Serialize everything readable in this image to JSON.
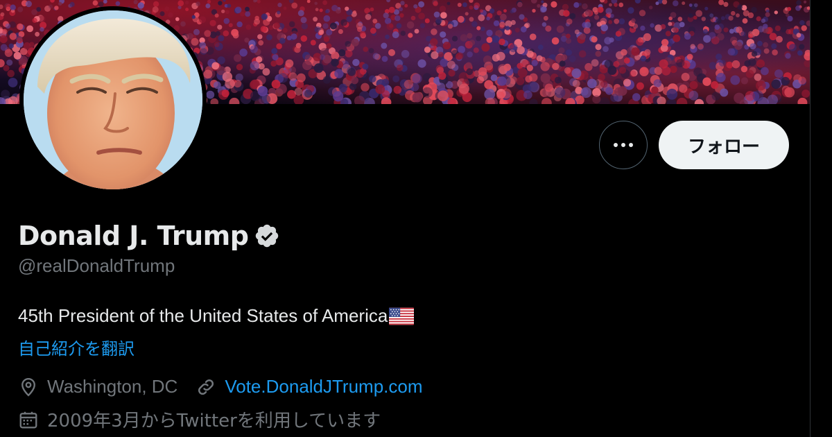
{
  "profile": {
    "display_name": "Donald J. Trump",
    "handle": "@realDonaldTrump",
    "verified": true,
    "bio": "45th President of the United States of America",
    "bio_emoji": "us-flag",
    "translate_label": "自己紹介を翻訳",
    "location": "Washington, DC",
    "website": "Vote.DonaldJTrump.com",
    "joined": "2009年3月からTwitterを利用しています"
  },
  "actions": {
    "more_icon": "more-horizontal-icon",
    "follow_label": "フォロー"
  },
  "icons": {
    "location": "location-pin-icon",
    "link": "link-icon",
    "calendar": "calendar-icon",
    "verified": "verified-badge-icon"
  },
  "colors": {
    "background": "#000000",
    "text_primary": "#e7e9ea",
    "text_secondary": "#71767b",
    "link": "#1d9bf0",
    "follow_button_bg": "#eff3f4"
  }
}
